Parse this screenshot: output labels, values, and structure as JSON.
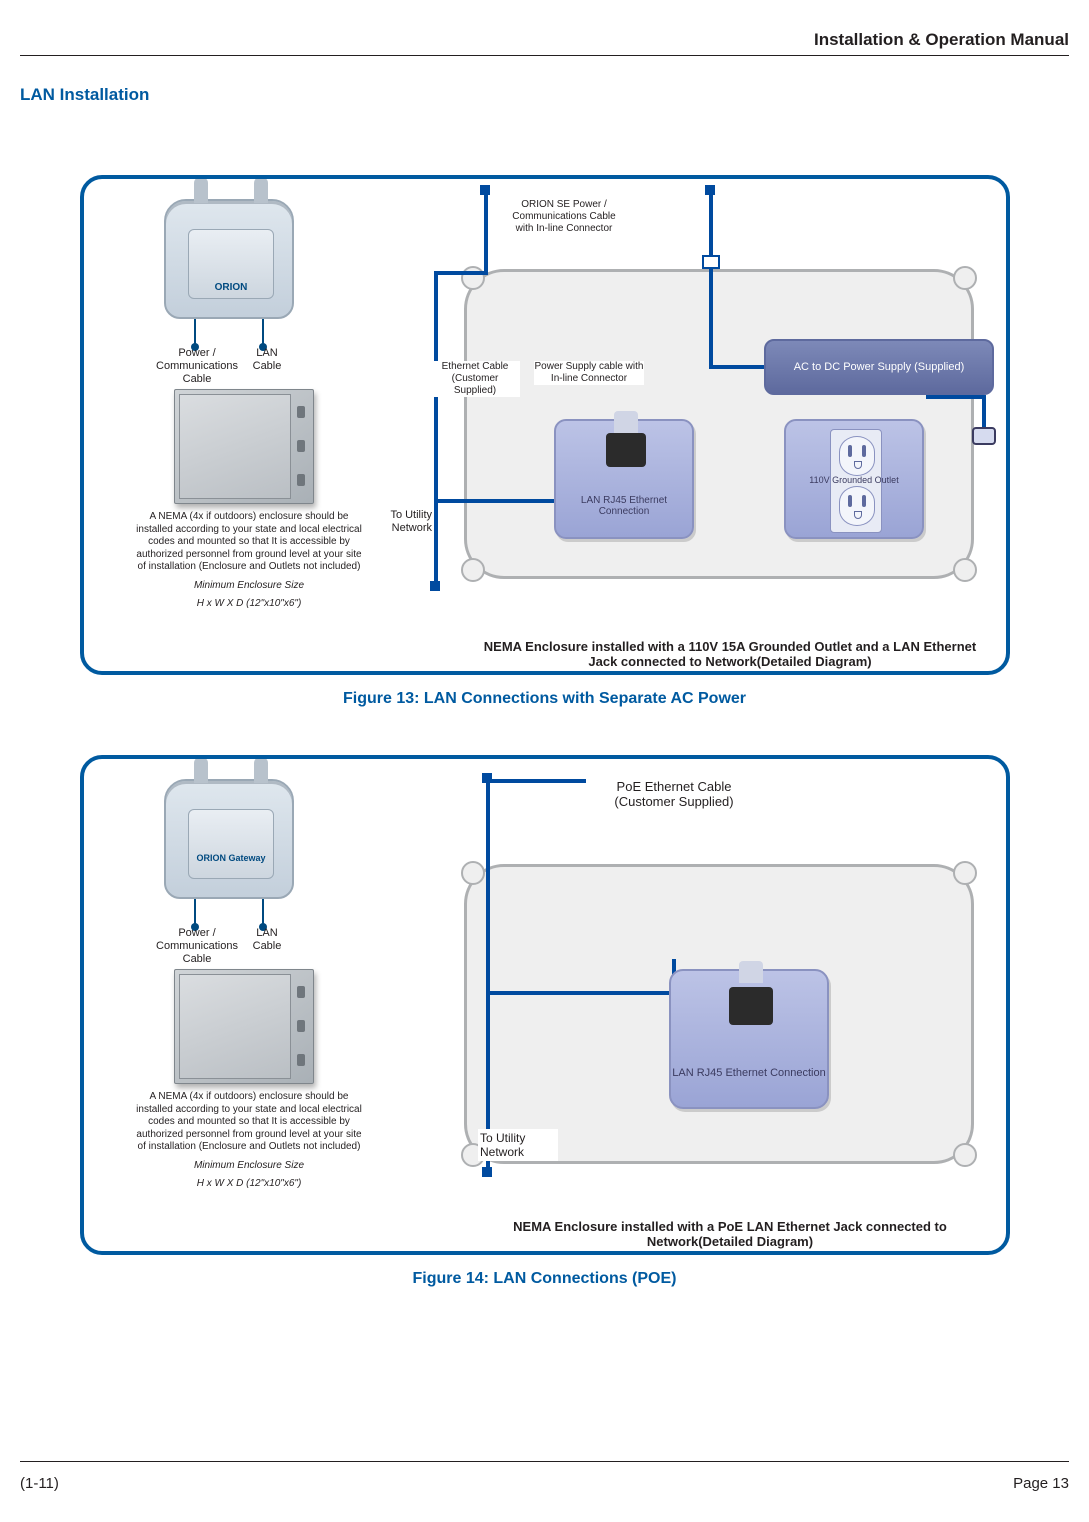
{
  "header": {
    "title": "Installation & Operation Manual"
  },
  "section": {
    "title": "LAN Installation"
  },
  "figure13": {
    "caption": "Figure 13:  LAN Connections with Separate AC Power",
    "orion_label": "ORION",
    "power_comm_label": "Power / Communications Cable",
    "lan_cable_label": "LAN Cable",
    "nema_text": "A NEMA (4x if outdoors) enclosure should be installed according to your state and local electrical codes and mounted so that It is accessible by authorized personnel from ground level at your site of installation (Enclosure and Outlets not included)",
    "nema_min_label": "Minimum Enclosure Size",
    "nema_min_dims": "H x W X D (12\"x10\"x6\")",
    "orion_se_label": "ORION SE Power / Communications Cable with In-line Connector",
    "eth_cust_label": "Ethernet Cable (Customer Supplied)",
    "psu_cable_label": "Power Supply cable with In-line Connector",
    "psu_label": "AC to DC Power Supply (Supplied)",
    "rj45_label": "LAN RJ45 Ethernet Connection",
    "outlet_label": "110V Grounded Outlet",
    "to_utility": "To Utility Network",
    "bottom_caption": "NEMA Enclosure installed with a 110V 15A Grounded Outlet and a LAN Ethernet Jack connected to Network(Detailed Diagram)"
  },
  "figure14": {
    "caption": "Figure 14:  LAN Connections (POE)",
    "orion_label": "ORION Gateway",
    "power_comm_label": "Power / Communications Cable",
    "lan_cable_label": "LAN Cable",
    "nema_text": "A NEMA (4x if outdoors) enclosure should be installed according to your state and local electrical codes and mounted so that It is accessible by authorized personnel from ground level at your site of installation (Enclosure and Outlets not included)",
    "nema_min_label": "Minimum Enclosure Size",
    "nema_min_dims": "H x W X D (12\"x10\"x6\")",
    "poe_label": "PoE Ethernet Cable (Customer Supplied)",
    "rj45_label": "LAN RJ45 Ethernet Connection",
    "to_utility": "To Utility Network",
    "bottom_caption": "NEMA Enclosure installed with a PoE LAN Ethernet Jack connected to Network(Detailed Diagram)"
  },
  "footer": {
    "left": "(1-11)",
    "right": "Page 13"
  }
}
